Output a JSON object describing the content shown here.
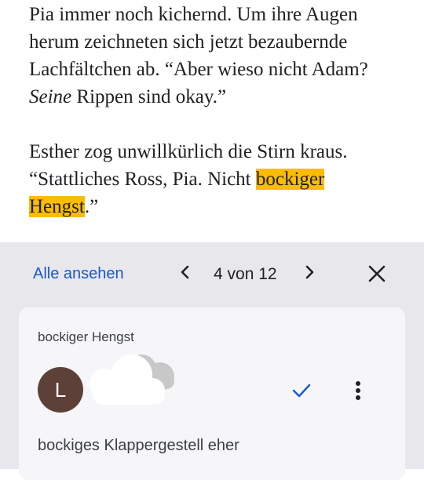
{
  "document": {
    "line1": "Pia immer noch kichernd. Um ihre Augen",
    "line2": "herum zeichneten sich jetzt bezaubernde",
    "line3": "Lachfältchen ab. “Aber wieso nicht Adam?",
    "line4_italic": "Seine",
    "line4_rest": " Rippen sind okay.”",
    "line5": "Esther zog unwillkürlich die Stirn kraus.",
    "line6_pre": "“Stattliches Ross, Pia. Nicht ",
    "line6_highlight": "bockiger",
    "line7_highlight": "Hengst",
    "line7_rest": ".”",
    "highlight_color": "#fbbc04"
  },
  "comments_toolbar": {
    "see_all": "Alle ansehen",
    "counter": "4 von 12",
    "prev_icon": "chevron-left-icon",
    "next_icon": "chevron-right-icon",
    "close_icon": "close-icon"
  },
  "comment_card": {
    "quoted_text": "bockiger Hengst",
    "avatar_initial": "L",
    "avatar_color": "#5d4037",
    "comment_text": "bockiges Klappergestell eher",
    "resolve_icon": "check-icon",
    "more_icon": "more-vertical-icon"
  }
}
